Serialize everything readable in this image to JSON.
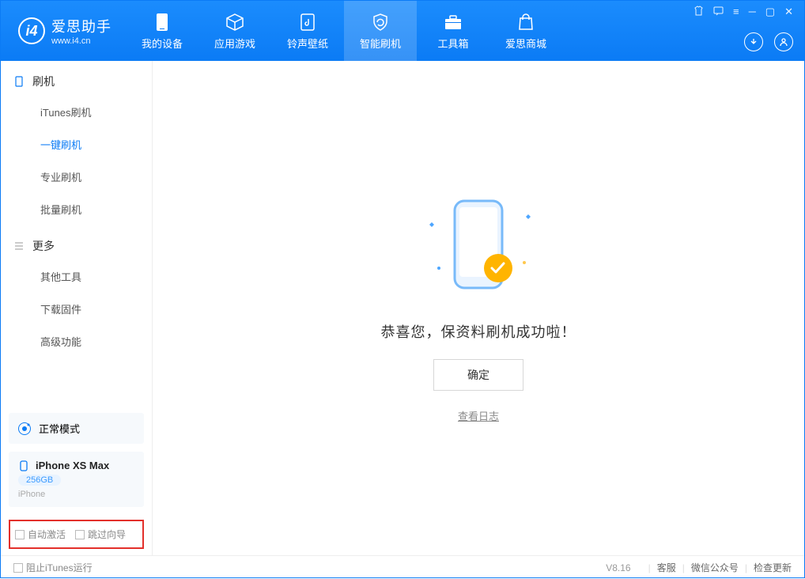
{
  "app": {
    "title": "爱思助手",
    "url": "www.i4.cn"
  },
  "nav": {
    "items": [
      {
        "label": "我的设备"
      },
      {
        "label": "应用游戏"
      },
      {
        "label": "铃声壁纸"
      },
      {
        "label": "智能刷机"
      },
      {
        "label": "工具箱"
      },
      {
        "label": "爱思商城"
      }
    ]
  },
  "sidebar": {
    "group1": {
      "title": "刷机",
      "items": [
        "iTunes刷机",
        "一键刷机",
        "专业刷机",
        "批量刷机"
      ]
    },
    "group2": {
      "title": "更多",
      "items": [
        "其他工具",
        "下载固件",
        "高级功能"
      ]
    },
    "mode_card": {
      "label": "正常模式"
    },
    "device_card": {
      "name": "iPhone XS Max",
      "storage": "256GB",
      "type": "iPhone"
    },
    "checkboxes": {
      "auto_activate": "自动激活",
      "skip_guide": "跳过向导"
    }
  },
  "main": {
    "success_text": "恭喜您，保资料刷机成功啦！",
    "ok_button": "确定",
    "log_link": "查看日志"
  },
  "footer": {
    "block_itunes": "阻止iTunes运行",
    "version": "V8.16",
    "links": [
      "客服",
      "微信公众号",
      "检查更新"
    ]
  }
}
